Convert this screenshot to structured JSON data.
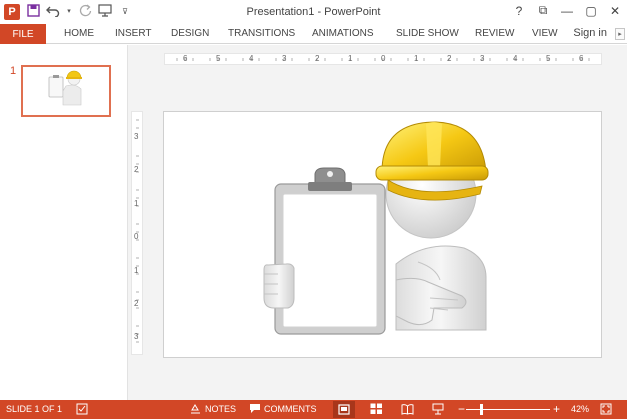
{
  "app": {
    "logo_letter": "P",
    "window_title": "Presentation1 - PowerPoint",
    "accent_color": "#d24726"
  },
  "qat": {
    "icons": [
      "powerpoint-logo",
      "save-icon",
      "undo-icon",
      "undo-dropdown-icon",
      "redo-icon",
      "start-from-beginning-icon",
      "customize-qat-icon"
    ]
  },
  "window_controls": {
    "help": "?",
    "ribbon_display": "⧉",
    "minimize": "—",
    "restore": "▢",
    "close": "✕"
  },
  "ribbon": {
    "tabs": [
      "FILE",
      "HOME",
      "INSERT",
      "DESIGN",
      "TRANSITIONS",
      "ANIMATIONS",
      "SLIDE SHOW",
      "REVIEW",
      "VIEW"
    ],
    "sign_in": "Sign in"
  },
  "thumbnails": [
    {
      "number": "1",
      "selected": true
    }
  ],
  "rulers": {
    "horizontal": [
      "6",
      "5",
      "4",
      "3",
      "2",
      "1",
      "0",
      "1",
      "2",
      "3",
      "4",
      "5",
      "6"
    ],
    "vertical": [
      "3",
      "2",
      "1",
      "0",
      "1",
      "2",
      "3"
    ]
  },
  "status": {
    "slide_info": "SLIDE 1 OF 1",
    "notes": "NOTES",
    "comments": "COMMENTS",
    "zoom_minus": "−",
    "zoom_plus": "+",
    "zoom_level": "42%",
    "zoom_fraction": 0.42
  }
}
